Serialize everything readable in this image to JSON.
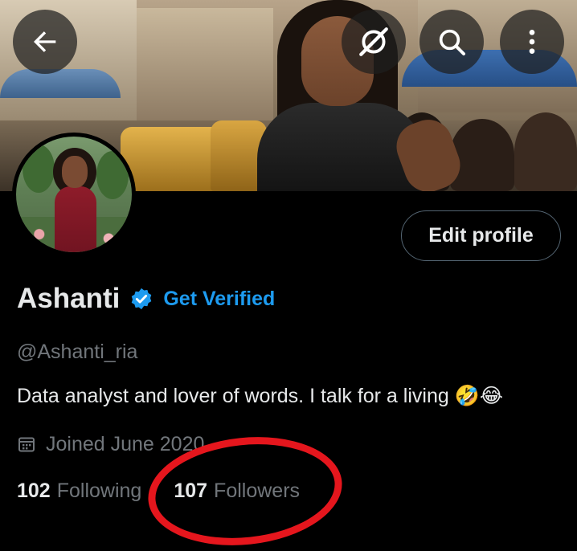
{
  "header": {
    "back_icon": "arrow-left-icon",
    "grok_icon": "grok-icon",
    "search_icon": "search-icon",
    "more_icon": "more-vertical-icon"
  },
  "profile": {
    "edit_label": "Edit profile",
    "name": "Ashanti",
    "get_verified_label": "Get Verified",
    "handle": "@Ashanti_ria",
    "bio": "Data analyst and lover of words.  I talk for a living 🤣😂",
    "joined": "Joined June 2020",
    "following_count": "102",
    "following_label": "Following",
    "followers_count": "107",
    "followers_label": "Followers"
  },
  "colors": {
    "accent": "#1d9bf0",
    "text_primary": "#e7e9ea",
    "text_secondary": "#71767b",
    "annotation": "#e5161d"
  }
}
